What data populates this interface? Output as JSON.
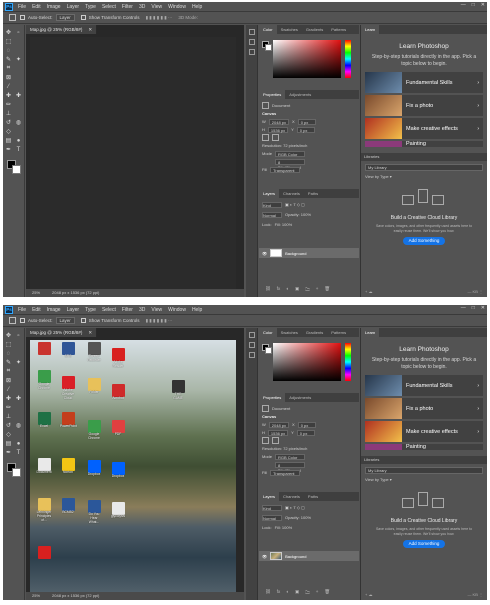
{
  "menu": {
    "logo": "Ps",
    "items": [
      "File",
      "Edit",
      "Image",
      "Layer",
      "Type",
      "Select",
      "Filter",
      "3D",
      "View",
      "Window",
      "Help"
    ],
    "window_controls": [
      "—",
      "□",
      "✕"
    ]
  },
  "options": {
    "auto_select": "Auto-Select:",
    "layer_value": "Layer",
    "show_transform": "Show Transform Controls",
    "mode_3d": "3D Mode:"
  },
  "document": {
    "tab_title": "Map.jpg @ 25% (RGB/8#)",
    "tab_close": "✕",
    "zoom": "25%",
    "info": "2048 px x 1536 px (72 ppi)"
  },
  "panels": {
    "color_tabs": [
      "Color",
      "Swatches",
      "Gradients",
      "Patterns"
    ],
    "props_tabs": [
      "Properties",
      "Adjustments"
    ],
    "props_type": "Document",
    "canvas_label": "Canvas",
    "w_label": "W",
    "h_label": "H",
    "x_label": "X",
    "y_label": "Y",
    "width": "2048 px",
    "height": "1536 px",
    "x": "0 px",
    "y": "0 px",
    "resolution": "Resolution: 72 pixels/inch",
    "mode_label": "Mode",
    "mode": "RGB Color",
    "depth": "8 Bits/Channel",
    "fill_label": "Fill",
    "fill": "Transparent",
    "layers_tabs": [
      "Layers",
      "Channels",
      "Paths"
    ],
    "kind_label": "Kind",
    "blend": "Normal",
    "opacity": "Opacity: 100%",
    "lock": "Lock:",
    "fill_pct": "Fill: 100%",
    "layer_name": "Background",
    "layer_footer": [
      "⛓",
      "fx",
      "◐",
      "▣",
      "🗀",
      "+",
      "🗑"
    ]
  },
  "learn": {
    "tab": "Learn",
    "title": "Learn Photoshop",
    "desc": "Step-by-step tutorials directly in the app. Pick a topic below to begin.",
    "tutorials": [
      "Fundamental Skills",
      "Fix a photo",
      "Make creative effects",
      "Painting"
    ]
  },
  "libraries": {
    "tab": "Libraries",
    "dropdown": "My Library",
    "view": "View by Type ▾",
    "cta": "Build a Creative Cloud Library",
    "sub": "Save colors, images, and other frequently used assets here to easily reuse them. We'll show you how.",
    "button": "Add Something",
    "footer_left": "+  ☁",
    "footer_right": "— KB  ⋮"
  },
  "desktop_icons": [
    {
      "label": "",
      "color": "#c9342f"
    },
    {
      "label": "SRS",
      "color": "#2f5597"
    },
    {
      "label": "Screen Recorder",
      "color": "#555"
    },
    {
      "label": "Adobe Reader",
      "color": "#d8201f"
    },
    {
      "label": "Google Chrome",
      "color": "#3a9d4a"
    },
    {
      "label": "Adobe Creative Cloud",
      "color": "#da1f26"
    },
    {
      "label": "Folder",
      "color": "#e8c15a"
    },
    {
      "label": "Acrobat",
      "color": "#cf2a2a"
    },
    {
      "label": "THE GAME",
      "color": "#333"
    },
    {
      "label": "Excel",
      "color": "#1e7145"
    },
    {
      "label": "PowerPoint",
      "color": "#c43e1c"
    },
    {
      "label": "Google Chrome",
      "color": "#3a9d4a"
    },
    {
      "label": "PDF",
      "color": "#e04040"
    },
    {
      "label": "Document",
      "color": "#e9e9e9"
    },
    {
      "label": "Norton",
      "color": "#f3c614"
    },
    {
      "label": "Dropbox",
      "color": "#0061fe"
    },
    {
      "label": "Dropbox",
      "color": "#0061fe"
    },
    {
      "label": "Lehninger Principles of...",
      "color": "#e8c15a"
    },
    {
      "label": "BCMB2",
      "color": "#2b579a"
    },
    {
      "label": "Do You Hear What...",
      "color": "#2b579a"
    },
    {
      "label": "glycolysis",
      "color": "#e9e9e9"
    },
    {
      "label": "",
      "color": "#d8201f"
    }
  ]
}
